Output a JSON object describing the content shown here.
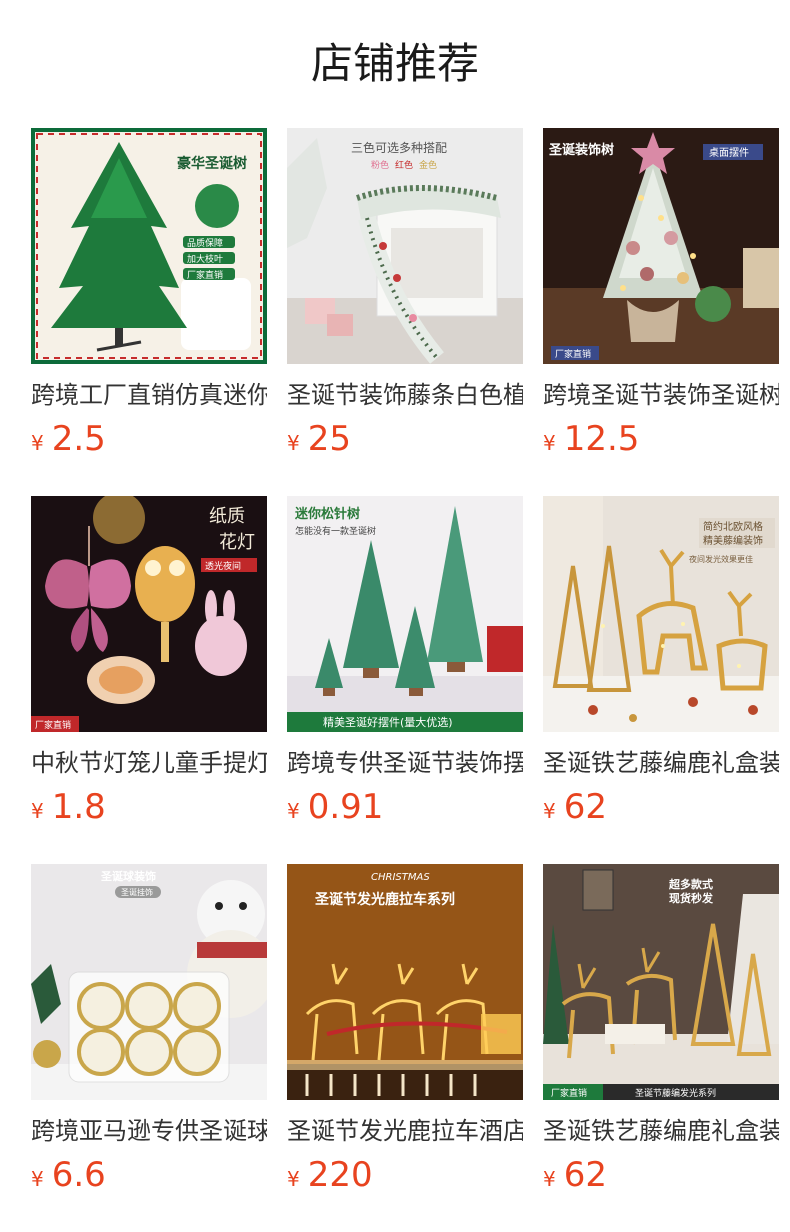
{
  "header": {
    "title": "店铺推荐"
  },
  "currency_symbol": "¥",
  "products": [
    {
      "name": "跨境工厂直销仿真迷你",
      "price": "2.5",
      "image_icon": "christmas-tree-icon",
      "image_text": [
        "豪华圣诞树",
        "品质保障",
        "加大枝叶",
        "厂家直销"
      ]
    },
    {
      "name": "圣诞节装饰藤条白色植绒",
      "price": "25",
      "image_icon": "garland-icon",
      "image_text": [
        "三色可选多种搭配",
        "粉色",
        "红色",
        "金色"
      ]
    },
    {
      "name": "跨境圣诞节装饰圣诞树",
      "price": "12.5",
      "image_icon": "christmas-tree-icon",
      "image_text": [
        "圣诞装饰树",
        "桌面摆件",
        "厂家直销"
      ]
    },
    {
      "name": "中秋节灯笼儿童手提灯",
      "price": "1.8",
      "image_icon": "lantern-icon",
      "image_text": [
        "纸质",
        "花灯",
        "透光夜间",
        "厂家直销"
      ]
    },
    {
      "name": "跨境专供圣诞节装饰摆件",
      "price": "0.91",
      "image_icon": "pine-tree-icon",
      "image_text": [
        "迷你松针树",
        "怎能没有一款圣诞树",
        "精美圣诞好摆件(量大优选)"
      ]
    },
    {
      "name": "圣诞铁艺藤编鹿礼盒装",
      "price": "62",
      "image_icon": "reindeer-icon",
      "image_text": [
        "简约北欧风格",
        "精美藤编装饰",
        "夜间发光效果更佳"
      ]
    },
    {
      "name": "跨境亚马逊专供圣诞球",
      "price": "6.6",
      "image_icon": "ornament-ball-icon",
      "image_text": [
        "圣诞球装饰",
        "圣诞挂饰"
      ]
    },
    {
      "name": "圣诞节发光鹿拉车酒店",
      "price": "220",
      "image_icon": "reindeer-sleigh-icon",
      "image_text": [
        "CHRISTMAS",
        "圣诞节发光鹿拉车系列"
      ]
    },
    {
      "name": "圣诞铁艺藤编鹿礼盒装",
      "price": "62",
      "image_icon": "reindeer-icon",
      "image_text": [
        "超多款式",
        "现货秒发",
        "厂家直销",
        "圣诞节藤编发光系列"
      ]
    }
  ]
}
